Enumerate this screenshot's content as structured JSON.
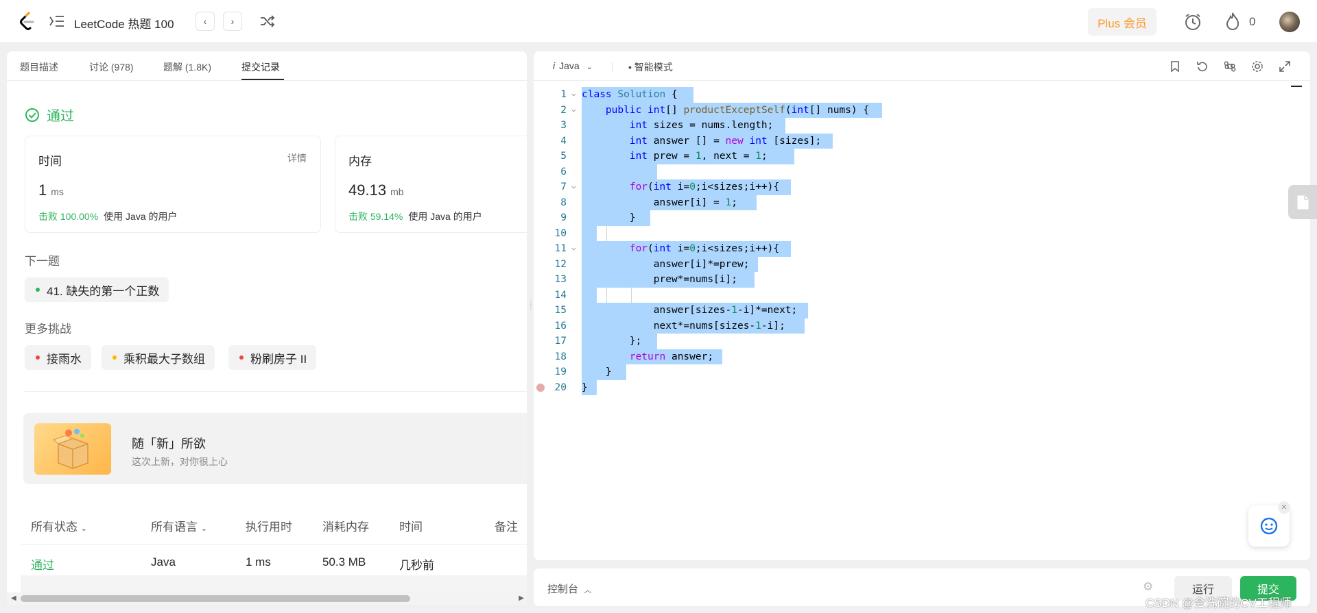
{
  "app": {
    "title": "LeetCode 热题 100",
    "nav_prev": "‹",
    "nav_next": "›"
  },
  "header": {
    "plus_label": "Plus 会员",
    "fire_count": "0"
  },
  "left_tabs": [
    "题目描述",
    "讨论 (978)",
    "题解 (1.8K)",
    "提交记录"
  ],
  "result": {
    "status": "通过"
  },
  "stats": {
    "time": {
      "label": "时间",
      "detail": "详情",
      "value": "1",
      "unit": "ms",
      "beat": "击败 100.00%",
      "beat_suffix": "使用 Java 的用户"
    },
    "memory": {
      "label": "内存",
      "value": "49.13",
      "unit": "mb",
      "beat": "击败 59.14%",
      "beat_suffix": "使用 Java 的用户"
    }
  },
  "next_problem": {
    "heading": "下一题",
    "title": "41. 缺失的第一个正数"
  },
  "more": {
    "heading": "更多挑战",
    "items": [
      "接雨水",
      "乘积最大子数组",
      "粉刷房子 II"
    ]
  },
  "promo": {
    "title": "随「新」所欲",
    "subtitle": "这次上新，对你很上心"
  },
  "table": {
    "headers": [
      "所有状态",
      "所有语言",
      "执行用时",
      "消耗内存",
      "时间",
      "备注"
    ],
    "rows": [
      [
        "通过",
        "Java",
        "1 ms",
        "50.3 MB",
        "几秒前"
      ]
    ]
  },
  "editor": {
    "language": "Java",
    "mode": "智能模式",
    "line_numbers": [
      "1",
      "2",
      "3",
      "4",
      "5",
      "6",
      "7",
      "8",
      "9",
      "10",
      "11",
      "12",
      "13",
      "14",
      "15",
      "16",
      "17",
      "18",
      "19",
      "20"
    ]
  },
  "console": {
    "label": "控制台",
    "run": "运行",
    "submit": "提交"
  },
  "watermark": "CSDN @会洗碗的CV工程师",
  "colors": {
    "accent_green": "#2db55d",
    "plus_orange": "#ff9a2e",
    "selection": "#add6ff"
  }
}
